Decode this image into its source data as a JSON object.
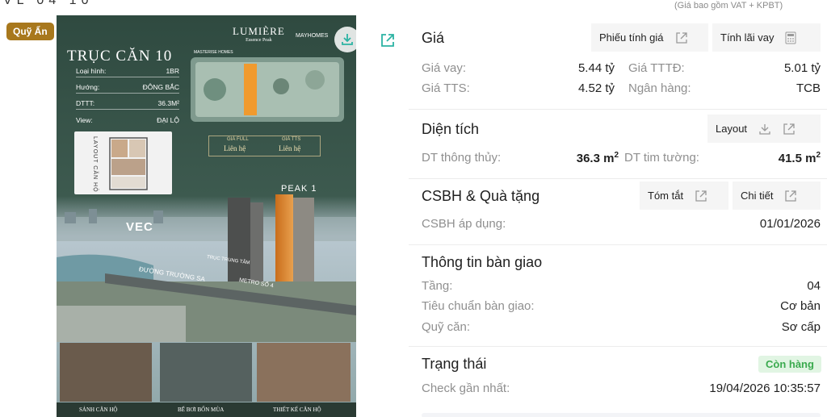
{
  "top_note": "(Giá bao gồm VAT + KPBT)",
  "top_cut": "VL 04 10",
  "badge": "Quỹ Ẩn",
  "poster": {
    "brand_left": "MASTERISE HOMES",
    "brand_center": "LUMIÈRE",
    "brand_center_sub": "Essence Peak",
    "brand_right": "MAYHOMES",
    "title": "TRỤC CĂN 10",
    "rows": [
      {
        "label": "Loại hình:",
        "value": "1BR"
      },
      {
        "label": "Hướng:",
        "value": "ĐÔNG BẮC"
      },
      {
        "label": "DTTT:",
        "value": "36.3M²"
      },
      {
        "label": "View:",
        "value": "ĐẠI LỘ"
      }
    ],
    "price_full_label": "GIÁ FULL",
    "price_full_value": "Liên hệ",
    "price_tts_label": "GIÁ TTS",
    "price_tts_value": "Liên hệ",
    "layout_label": "LAYOUT CĂN HỘ",
    "vec": "VEC",
    "peak": "PEAK 1",
    "road1": "TRỤC TRUNG TÂM",
    "road2": "ĐƯỜNG TRƯỜNG SA",
    "road3": "METRO SỐ 4",
    "captions": [
      "SẢNH CĂN HỘ",
      "BỂ BƠI BỐN MÙA",
      "THIẾT KẾ CĂN HỘ"
    ],
    "icons": [
      "download-icon"
    ]
  },
  "panel": {
    "price": {
      "title": "Giá",
      "btn_sheet": "Phiếu tính giá",
      "btn_interest": "Tính lãi vay",
      "items": [
        {
          "label": "Giá vay:",
          "value": "5.44 tỷ"
        },
        {
          "label": "Giá TTTĐ:",
          "value": "5.01 tỷ"
        },
        {
          "label": "Giá TTS:",
          "value": "4.52 tỷ"
        },
        {
          "label": "Ngân hàng:",
          "value": "TCB"
        }
      ]
    },
    "area": {
      "title": "Diện tích",
      "btn_layout": "Layout",
      "items": [
        {
          "label": "DT thông thủy:",
          "value": "36.3 m",
          "sup": "2"
        },
        {
          "label": "DT tim tường:",
          "value": "41.5 m",
          "sup": "2"
        }
      ]
    },
    "policy": {
      "title": "CSBH & Quà tặng",
      "btn_summary": "Tóm tắt",
      "btn_detail": "Chi tiết",
      "items": [
        {
          "label": "CSBH áp dụng:",
          "value": "01/01/2026"
        }
      ]
    },
    "handover": {
      "title": "Thông tin bàn giao",
      "items": [
        {
          "label": "Tầng:",
          "value": "04"
        },
        {
          "label": "Tiêu chuẩn bàn giao:",
          "value": "Cơ bản"
        },
        {
          "label": "Quỹ căn:",
          "value": "Sơ cấp"
        }
      ]
    },
    "status": {
      "title": "Trạng thái",
      "badge": "Còn hàng",
      "check_label": "Check gần nhất:",
      "check_value": "19/04/2026 10:35:57"
    }
  },
  "colors": {
    "badge": "#a8781d",
    "status_green": "#3aaa4e",
    "status_bg": "#e1f5e3",
    "icon_teal": "#2bb3a3"
  }
}
